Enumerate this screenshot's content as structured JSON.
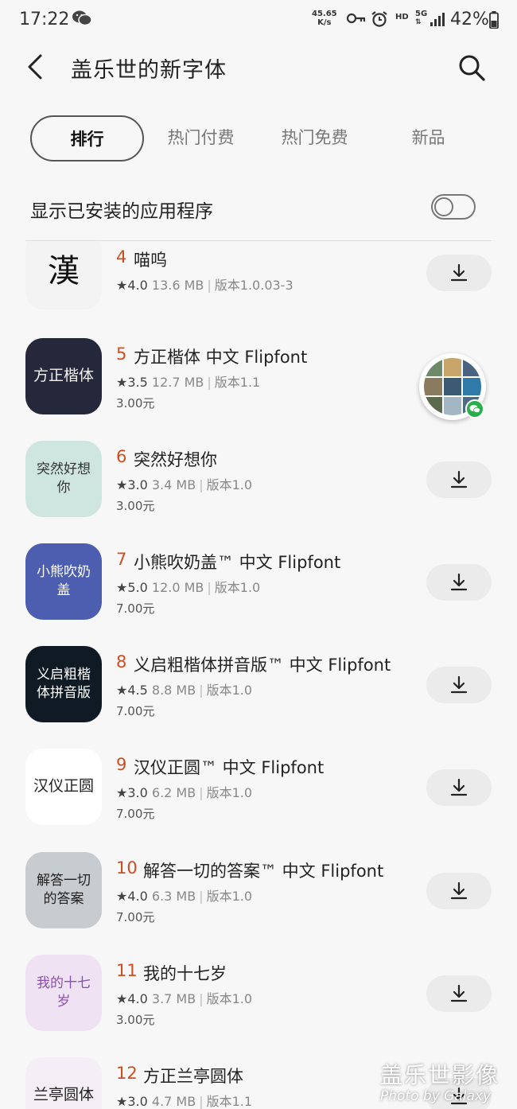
{
  "status_bar": {
    "time": "17:22",
    "speed_value": "45.65",
    "speed_unit": "K/s",
    "hd": "HD",
    "network": "5G",
    "battery": "42%"
  },
  "header": {
    "title": "盖乐世的新字体"
  },
  "tabs": [
    {
      "label": "排行",
      "active": true
    },
    {
      "label": "热门付费",
      "active": false
    },
    {
      "label": "热门免费",
      "active": false
    },
    {
      "label": "新品",
      "active": false
    }
  ],
  "toggle": {
    "label": "显示已安装的应用程序",
    "on": false
  },
  "apps": [
    {
      "rank": "4",
      "name": "喵呜",
      "rating": "4.0",
      "size": "13.6 MB",
      "version": "版本1.0.03-3",
      "price": "",
      "icon_text": "漢",
      "icon_bg": "#f3f3f3",
      "icon_fg": "#111"
    },
    {
      "rank": "5",
      "name": "方正楷体 中文 Flipfont",
      "rating": "3.5",
      "size": "12.7 MB",
      "version": "版本1.1",
      "price": "3.00元",
      "icon_text": "方正楷体",
      "icon_bg": "#25283a",
      "icon_fg": "#f0f0f0"
    },
    {
      "rank": "6",
      "name": "突然好想你",
      "rating": "3.0",
      "size": "3.4 MB",
      "version": "版本1.0",
      "price": "3.00元",
      "icon_text": "突然好想你",
      "icon_bg": "#cfe6e0",
      "icon_fg": "#333"
    },
    {
      "rank": "7",
      "name": "小熊吹奶盖™ 中文 Flipfont",
      "rating": "5.0",
      "size": "12.0 MB",
      "version": "版本1.0",
      "price": "7.00元",
      "icon_text": "小熊吹奶盖",
      "icon_bg": "#4d5db0",
      "icon_fg": "#ffffff"
    },
    {
      "rank": "8",
      "name": "义启粗楷体拼音版™ 中文 Flipfont",
      "rating": "4.5",
      "size": "8.8 MB",
      "version": "版本1.0",
      "price": "7.00元",
      "icon_text": "义启粗楷体拼音版",
      "icon_bg": "#0f1a24",
      "icon_fg": "#ffffff"
    },
    {
      "rank": "9",
      "name": "汉仪正圆™ 中文 Flipfont",
      "rating": "3.0",
      "size": "6.2 MB",
      "version": "版本1.0",
      "price": "7.00元",
      "icon_text": "汉仪正圆",
      "icon_bg": "#ffffff",
      "icon_fg": "#222"
    },
    {
      "rank": "10",
      "name": "解答一切的答案™ 中文 Flipfont",
      "rating": "4.0",
      "size": "6.3 MB",
      "version": "版本1.0",
      "price": "7.00元",
      "icon_text": "解答一切的答案",
      "icon_bg": "#c7ccd0",
      "icon_fg": "#222"
    },
    {
      "rank": "11",
      "name": "我的十七岁",
      "rating": "4.0",
      "size": "3.7 MB",
      "version": "版本1.0",
      "price": "3.00元",
      "icon_text": "我的十七岁",
      "icon_bg": "#efe3f3",
      "icon_fg": "#8a4fb0"
    },
    {
      "rank": "12",
      "name": "方正兰亭圆体",
      "rating": "3.0",
      "size": "4.7 MB",
      "version": "版本1.1",
      "price": "",
      "icon_text": "兰亭圆体",
      "icon_bg": "#f4eef6",
      "icon_fg": "#222"
    }
  ],
  "watermark": {
    "line1": "盖乐世影像",
    "line2": "Photo by Galaxy"
  },
  "colors": {
    "rank": "#d04d1f",
    "background": "#f7f7f7",
    "download_button": "#ebebeb"
  }
}
